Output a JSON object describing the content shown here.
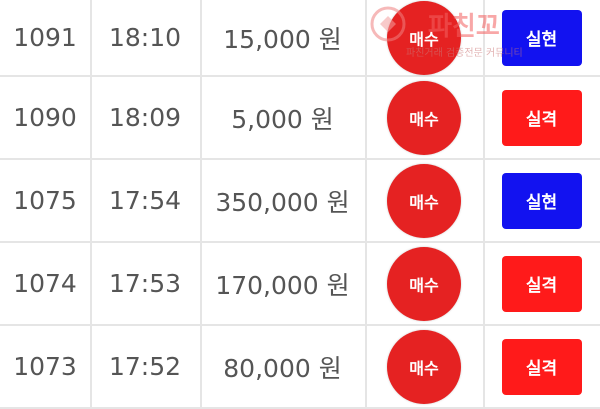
{
  "trades": [
    {
      "id": "1091",
      "time": "18:10",
      "amount": "15,000 원",
      "type": "매수",
      "result": "실현",
      "result_color": "#1212f0"
    },
    {
      "id": "1090",
      "time": "18:09",
      "amount": "5,000 원",
      "type": "매수",
      "result": "실격",
      "result_color": "#ff1a1a"
    },
    {
      "id": "1075",
      "time": "17:54",
      "amount": "350,000 원",
      "type": "매수",
      "result": "실현",
      "result_color": "#1212f0"
    },
    {
      "id": "1074",
      "time": "17:53",
      "amount": "170,000 원",
      "type": "매수",
      "result": "실격",
      "result_color": "#ff1a1a"
    },
    {
      "id": "1073",
      "time": "17:52",
      "amount": "80,000 원",
      "type": "매수",
      "result": "실격",
      "result_color": "#ff1a1a"
    }
  ],
  "watermark": {
    "main": "파친꼬",
    "sub": "파친거래 검증전문 커뮤니티"
  },
  "colors": {
    "buy": "#e52222",
    "win": "#1212f0",
    "lose": "#ff1a1a"
  }
}
